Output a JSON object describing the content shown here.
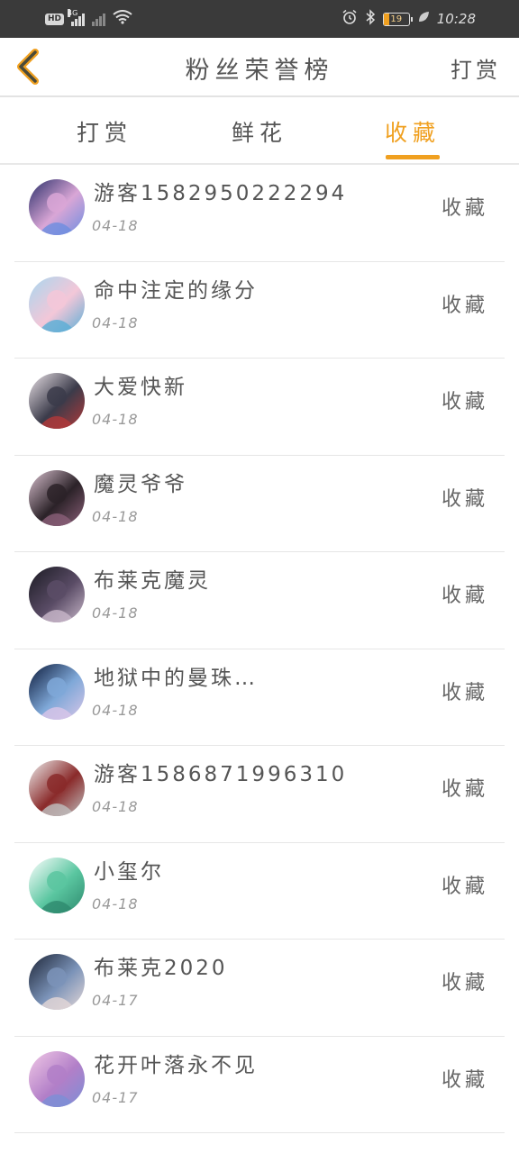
{
  "status_bar": {
    "hd": "HD",
    "network": "4G",
    "battery_level": "19",
    "time": "10:28"
  },
  "header": {
    "title": "粉丝荣誉榜",
    "action": "打赏"
  },
  "tabs": [
    {
      "label": "打赏",
      "active": false
    },
    {
      "label": "鲜花",
      "active": false
    },
    {
      "label": "收藏",
      "active": true
    }
  ],
  "accent_color": "#f0a020",
  "fans": [
    {
      "name": "游客1582950222294",
      "date": "04-18",
      "action": "收藏"
    },
    {
      "name": "命中注定的缘分",
      "date": "04-18",
      "action": "收藏"
    },
    {
      "name": "大爱快新",
      "date": "04-18",
      "action": "收藏"
    },
    {
      "name": "魔灵爷爷",
      "date": "04-18",
      "action": "收藏"
    },
    {
      "name": "布莱克魔灵",
      "date": "04-18",
      "action": "收藏"
    },
    {
      "name": "地狱中的曼珠…",
      "date": "04-18",
      "action": "收藏"
    },
    {
      "name": "游客1586871996310",
      "date": "04-18",
      "action": "收藏"
    },
    {
      "name": "小玺尔",
      "date": "04-18",
      "action": "收藏"
    },
    {
      "name": "布莱克2020",
      "date": "04-17",
      "action": "收藏"
    },
    {
      "name": "花开叶落永不见",
      "date": "04-17",
      "action": "收藏"
    }
  ]
}
